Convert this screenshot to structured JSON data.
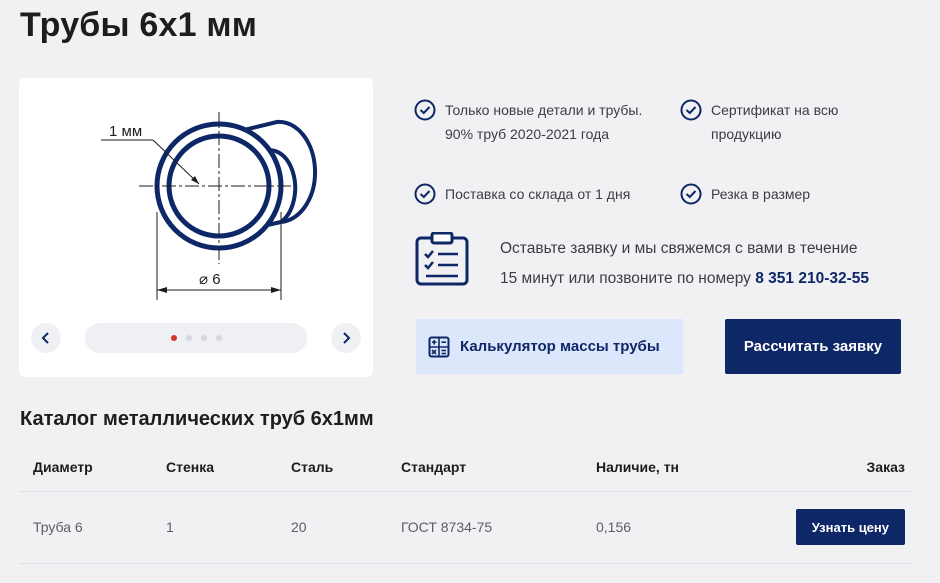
{
  "page": {
    "title": "Трубы 6х1 мм"
  },
  "drawing": {
    "wall_label": "1 мм",
    "diameter_label": "⌀ 6"
  },
  "carousel": {
    "slides": 4,
    "active_index": 0,
    "accent_color": "#d6342c"
  },
  "features": [
    {
      "text": "Только новые детали и трубы. 90% труб 2020-2021 года",
      "icon": "check-circle-icon"
    },
    {
      "text": "Сертификат на всю продукцию",
      "icon": "check-circle-icon"
    },
    {
      "text": "Поставка со склада от 1 дня",
      "icon": "check-circle-icon"
    },
    {
      "text": "Резка в размер",
      "icon": "check-circle-icon"
    }
  ],
  "contact": {
    "line1": "Оставьте заявку и мы свяжемся с вами в течение",
    "line2": "15 минут или позвоните по номеру ",
    "phone": "8 351 210-32-55",
    "icon": "clipboard-checklist-icon"
  },
  "buttons": {
    "calculator_label": "Калькулятор массы трубы",
    "calculator_icon": "calculator-icon",
    "request_label": "Рассчитать заявку"
  },
  "catalog": {
    "title": "Каталог металлических труб 6х1мм",
    "columns": [
      "Диаметр",
      "Стенка",
      "Сталь",
      "Стандарт",
      "Наличие, тн",
      "Заказ"
    ],
    "rows": [
      {
        "diameter": "Труба 6",
        "wall": "1",
        "steel": "20",
        "standard": "ГОСТ 8734-75",
        "stock": "0,156",
        "order_label": "Узнать цену"
      }
    ]
  },
  "colors": {
    "brand_navy": "#0d2767",
    "light_blue": "#dce7fb",
    "background": "#f1f1f3"
  }
}
